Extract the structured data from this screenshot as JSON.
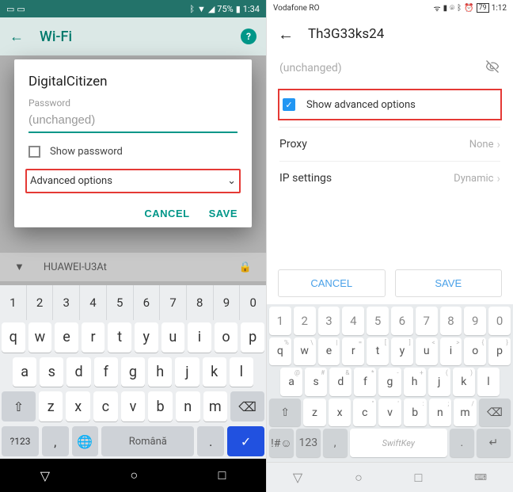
{
  "left": {
    "status": {
      "battery": "75%",
      "time": "1:34"
    },
    "header": {
      "title": "Wi-Fi"
    },
    "dialog": {
      "ssid": "DigitalCitizen",
      "password_label": "Password",
      "password_value": "(unchanged)",
      "show_password": "Show password",
      "advanced": "Advanced options",
      "cancel": "CANCEL",
      "save": "SAVE"
    },
    "wifi_item": "HUAWEI-U3At",
    "keyboard": {
      "row_num": [
        "1",
        "2",
        "3",
        "4",
        "5",
        "6",
        "7",
        "8",
        "9",
        "0"
      ],
      "row1": [
        "q",
        "w",
        "e",
        "r",
        "t",
        "y",
        "u",
        "i",
        "o",
        "p"
      ],
      "row2": [
        "a",
        "s",
        "d",
        "f",
        "g",
        "h",
        "j",
        "k",
        "l"
      ],
      "row3": [
        "z",
        "x",
        "c",
        "v",
        "b",
        "n",
        "m"
      ],
      "sym": "?123",
      "space": "Română"
    }
  },
  "right": {
    "status": {
      "carrier": "Vodafone RO",
      "battery_box": "79",
      "time": "1:12"
    },
    "header": {
      "title": "Th3G33ks24"
    },
    "password_value": "(unchanged)",
    "show_advanced": "Show advanced options",
    "proxy": {
      "label": "Proxy",
      "value": "None"
    },
    "ip": {
      "label": "IP settings",
      "value": "Dynamic"
    },
    "cancel": "CANCEL",
    "save": "SAVE",
    "keyboard": {
      "row_num": [
        "1",
        "2",
        "3",
        "4",
        "5",
        "6",
        "7",
        "8",
        "9",
        "0"
      ],
      "row1": [
        "q",
        "w",
        "e",
        "r",
        "t",
        "y",
        "u",
        "i",
        "o",
        "p"
      ],
      "row2": [
        "a",
        "s",
        "d",
        "f",
        "g",
        "h",
        "j",
        "k",
        "l"
      ],
      "row3": [
        "z",
        "x",
        "c",
        "v",
        "b",
        "n",
        "m"
      ],
      "space": "SwiftKey"
    }
  }
}
